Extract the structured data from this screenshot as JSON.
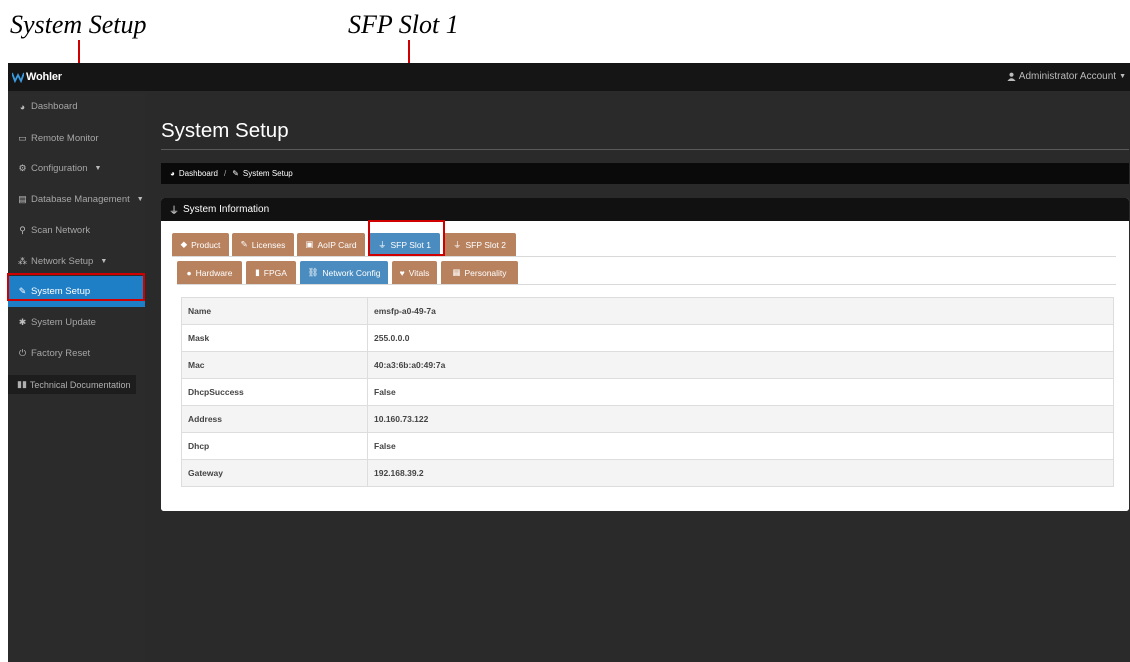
{
  "callouts": {
    "system_setup": "System Setup",
    "sfp_slot_1": "SFP Slot 1"
  },
  "header": {
    "logo_text": "Wohler",
    "account_label": "Administrator Account"
  },
  "sidebar": {
    "items": [
      {
        "label": "Dashboard",
        "icon": "dashboard-icon"
      },
      {
        "label": "Remote Monitor",
        "icon": "monitor-icon"
      },
      {
        "label": "Configuration",
        "icon": "cogs-icon"
      },
      {
        "label": "Database Management",
        "icon": "database-icon"
      },
      {
        "label": "Scan Network",
        "icon": "search-icon"
      },
      {
        "label": "Network Setup",
        "icon": "sitemap-icon"
      },
      {
        "label": "System Setup",
        "icon": "wrench-icon"
      },
      {
        "label": "System Update",
        "icon": "gear-icon"
      },
      {
        "label": "Factory Reset",
        "icon": "power-icon"
      }
    ],
    "doc_label": "Technical Documentation"
  },
  "main": {
    "title": "System Setup",
    "breadcrumb": {
      "home": "Dashboard",
      "separator": "/",
      "current": "System Setup"
    },
    "panel_title": "System Information",
    "tabs_row1": [
      {
        "label": "Product",
        "icon": "tag-icon"
      },
      {
        "label": "Licenses",
        "icon": "wrench-icon"
      },
      {
        "label": "AoIP Card",
        "icon": "card-icon"
      },
      {
        "label": "SFP Slot 1",
        "icon": "plug-icon"
      },
      {
        "label": "SFP Slot 2",
        "icon": "plug-icon"
      }
    ],
    "tabs_row2": [
      {
        "label": "Hardware",
        "icon": "info-icon"
      },
      {
        "label": "FPGA",
        "icon": "chip-icon"
      },
      {
        "label": "Network Config",
        "icon": "network-icon"
      },
      {
        "label": "Vitals",
        "icon": "heartbeat-icon"
      },
      {
        "label": "Personality",
        "icon": "id-card-icon"
      }
    ],
    "table": [
      {
        "key": "Name",
        "value": "emsfp-a0-49-7a"
      },
      {
        "key": "Mask",
        "value": "255.0.0.0"
      },
      {
        "key": "Mac",
        "value": "40:a3:6b:a0:49:7a"
      },
      {
        "key": "DhcpSuccess",
        "value": "False"
      },
      {
        "key": "Address",
        "value": "10.160.73.122"
      },
      {
        "key": "Dhcp",
        "value": "False"
      },
      {
        "key": "Gateway",
        "value": "192.168.39.2"
      }
    ]
  },
  "colors": {
    "active_blue": "#1f7fc6",
    "tab_brown": "#b8825f",
    "tab_blue": "#4a8cbf",
    "highlight_red": "#d00000"
  }
}
